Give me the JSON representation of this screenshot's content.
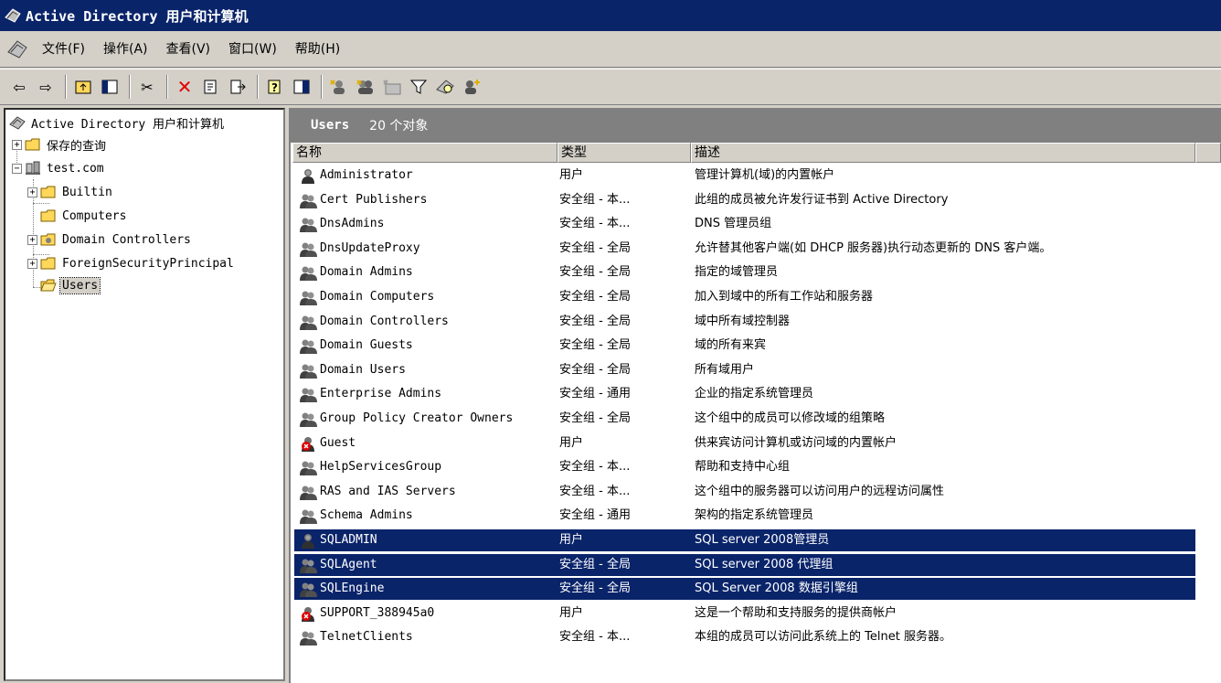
{
  "window": {
    "title": "Active Directory 用户和计算机"
  },
  "menu": [
    "文件(F)",
    "操作(A)",
    "查看(V)",
    "窗口(W)",
    "帮助(H)"
  ],
  "tree": {
    "root": "Active Directory 用户和计算机",
    "saved_queries": "保存的查询",
    "domain": "test.com",
    "children": [
      "Builtin",
      "Computers",
      "Domain Controllers",
      "ForeignSecurityPrincipal",
      "Users"
    ]
  },
  "pane": {
    "title": "Users",
    "count": "20 个对象"
  },
  "columns": [
    "名称",
    "类型",
    "描述"
  ],
  "rows": [
    {
      "name": "Administrator",
      "type": "用户",
      "desc": "管理计算机(域)的内置帐户",
      "icon": "user"
    },
    {
      "name": "Cert Publishers",
      "type": "安全组 - 本...",
      "desc": "此组的成员被允许发行证书到 Active Directory",
      "icon": "group"
    },
    {
      "name": "DnsAdmins",
      "type": "安全组 - 本...",
      "desc": "DNS 管理员组",
      "icon": "group"
    },
    {
      "name": "DnsUpdateProxy",
      "type": "安全组 - 全局",
      "desc": "允许替其他客户端(如 DHCP 服务器)执行动态更新的 DNS 客户端。",
      "icon": "group"
    },
    {
      "name": "Domain Admins",
      "type": "安全组 - 全局",
      "desc": "指定的域管理员",
      "icon": "group"
    },
    {
      "name": "Domain Computers",
      "type": "安全组 - 全局",
      "desc": "加入到域中的所有工作站和服务器",
      "icon": "group"
    },
    {
      "name": "Domain Controllers",
      "type": "安全组 - 全局",
      "desc": "域中所有域控制器",
      "icon": "group"
    },
    {
      "name": "Domain Guests",
      "type": "安全组 - 全局",
      "desc": "域的所有来宾",
      "icon": "group"
    },
    {
      "name": "Domain Users",
      "type": "安全组 - 全局",
      "desc": "所有域用户",
      "icon": "group"
    },
    {
      "name": "Enterprise Admins",
      "type": "安全组 - 通用",
      "desc": "企业的指定系统管理员",
      "icon": "group"
    },
    {
      "name": "Group Policy Creator Owners",
      "type": "安全组 - 全局",
      "desc": "这个组中的成员可以修改域的组策略",
      "icon": "group"
    },
    {
      "name": "Guest",
      "type": "用户",
      "desc": "供来宾访问计算机或访问域的内置帐户",
      "icon": "user-disabled"
    },
    {
      "name": "HelpServicesGroup",
      "type": "安全组 - 本...",
      "desc": "帮助和支持中心组",
      "icon": "group"
    },
    {
      "name": "RAS and IAS Servers",
      "type": "安全组 - 本...",
      "desc": "这个组中的服务器可以访问用户的远程访问属性",
      "icon": "group"
    },
    {
      "name": "Schema Admins",
      "type": "安全组 - 通用",
      "desc": "架构的指定系统管理员",
      "icon": "group"
    },
    {
      "name": "SQLADMIN",
      "type": "用户",
      "desc": "SQL server 2008管理员",
      "icon": "user"
    },
    {
      "name": "SQLAgent",
      "type": "安全组 - 全局",
      "desc": "SQL server 2008 代理组",
      "icon": "group"
    },
    {
      "name": "SQLEngine",
      "type": "安全组 - 全局",
      "desc": "SQL Server 2008 数据引擎组",
      "icon": "group"
    },
    {
      "name": "SUPPORT_388945a0",
      "type": "用户",
      "desc": "这是一个帮助和支持服务的提供商帐户",
      "icon": "user-disabled"
    },
    {
      "name": "TelnetClients",
      "type": "安全组 - 本...",
      "desc": "本组的成员可以访问此系统上的 Telnet 服务器。",
      "icon": "group"
    }
  ],
  "selected_rows": [
    15,
    16,
    17
  ],
  "colors": {
    "title_bar": "#0a246a",
    "selection": "#0a246a",
    "face": "#d4d0c8",
    "header_band": "#808080"
  }
}
